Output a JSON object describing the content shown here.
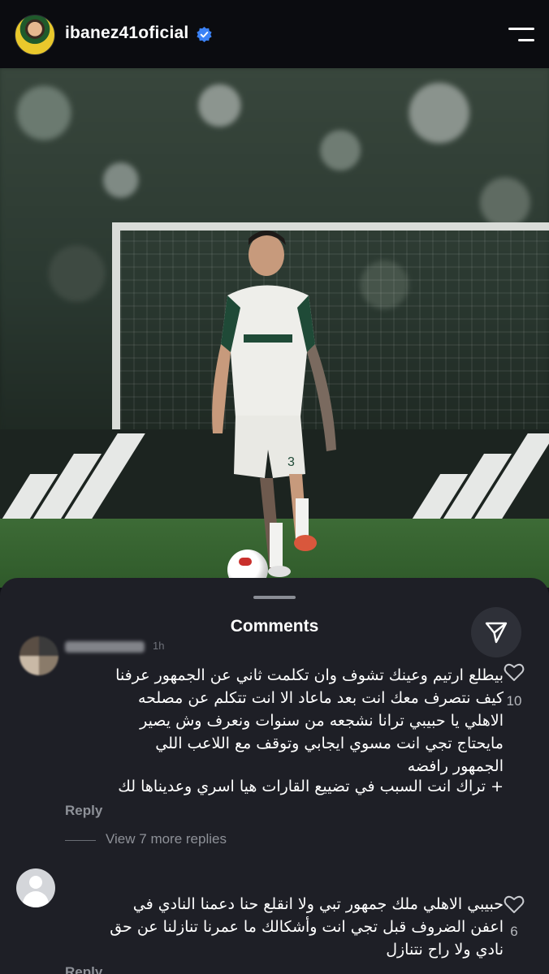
{
  "header": {
    "username": "ibanez41oficial",
    "verified_icon": "verified-badge-icon",
    "menu_icon": "hamburger-menu-icon"
  },
  "sheet": {
    "title": "Comments",
    "share_icon": "send-icon"
  },
  "comments": [
    {
      "time": "1h",
      "lines": [
        "بيطلع ارتيم وعينك تشوف وان تكلمت ثاني عن الجمهور عرفنا",
        "كيف نتصرف معك انت بعد ماعاد الا انت تتكلم عن مصلحه",
        "الاهلي يا حبيبي ترانا نشجعه من سنوات ونعرف وش يصير",
        "مايحتاج تجي انت مسوي ايجابي وتوقف مع اللاعب اللي",
        "الجمهور رافضه",
        "+ تراك انت السبب في تضييع القارات هيا اسري وعديناها لك"
      ],
      "reply_label": "Reply",
      "likes": "10",
      "view_replies": "View 7 more replies"
    },
    {
      "lines": [
        "حبيبي الاهلي ملك جمهور تبي ولا انقلع حنا دعمنا النادي في",
        "اعفن الضروف قبل تجي انت وأشكالك ما عمرنا تنازلنا عن حق",
        "نادي ولا راح نتنازل"
      ],
      "reply_label": "Reply",
      "likes": "6"
    }
  ],
  "colors": {
    "background": "#0f1116",
    "sheet": "#1e1f26",
    "muted_text": "#8e9198",
    "verified": "#3b82f6"
  }
}
